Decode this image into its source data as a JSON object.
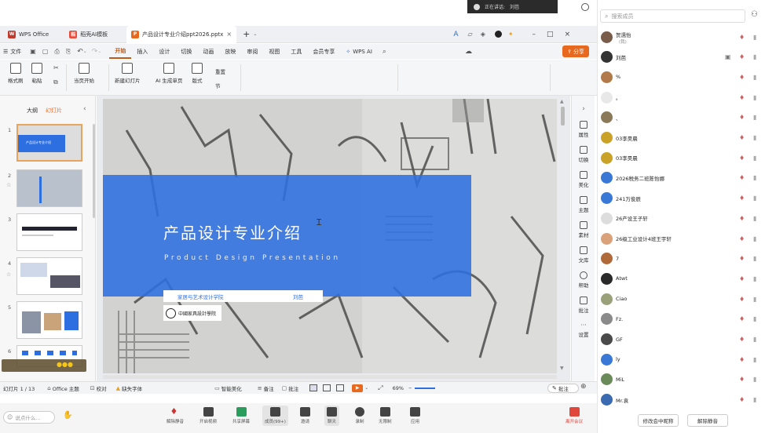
{
  "speaking": {
    "label": "正在讲话:",
    "name": "刘芭"
  },
  "tabs": [
    {
      "label": "WPS Office",
      "logo": "W",
      "color": "#c0392b"
    },
    {
      "label": "稻壳AI模板",
      "logo": "稻",
      "color": "#e74c3c"
    },
    {
      "label": "产品设计专业介绍ppt2026.pptx",
      "logo": "P",
      "color": "#e8681e"
    }
  ],
  "menu": {
    "file": "文件",
    "items": [
      "开始",
      "插入",
      "设计",
      "切换",
      "动画",
      "放映",
      "审阅",
      "视图",
      "工具",
      "会员专享"
    ],
    "wps_ai": "WPS AI",
    "share": "分享"
  },
  "ribbon": {
    "format_painter": "格式刷",
    "paste": "粘贴",
    "play_from_current": "当页开始",
    "new_slide": "新建幻灯片",
    "ai_generate": "AI 生成单页",
    "layout": "版式",
    "section": "节",
    "reset": "重置"
  },
  "outline": {
    "tab_outline": "大纲",
    "tab_slides": "幻灯片"
  },
  "slides": [
    "1",
    "2",
    "3",
    "4",
    "5",
    "6"
  ],
  "thumb1_title": "产品设计专业介绍",
  "slide": {
    "title": "产品设计专业介绍",
    "subtitle": "Product Design Presentation",
    "department": "家居与艺术设计学院",
    "author": "刘芭",
    "seal_text": "中國家具設計學院"
  },
  "rail": [
    "属性",
    "切换",
    "美化",
    "主题",
    "素材",
    "文库",
    "帮助",
    "批注",
    "设置"
  ],
  "statusbar": {
    "slide_count": "幻灯片 1 / 13",
    "theme": "Office 主题",
    "proofread": "校对",
    "missing_font": "缺失字体",
    "smart_beautify": "智能美化",
    "notes": "备注",
    "comments": "批注",
    "zoom": "69%",
    "annotate": "批注"
  },
  "meeting": {
    "say_something": "说点什么...",
    "controls": [
      "解除静音",
      "开启视频",
      "共享屏幕",
      "成员(99+)",
      "邀请",
      "聊天",
      "录制",
      "无限制",
      "应用"
    ],
    "leave": "离开会议"
  },
  "panel": {
    "search_placeholder": "搜索成员",
    "members": [
      {
        "name": "贺濡怡",
        "sub": "(我)",
        "color": "#7a5c4a"
      },
      {
        "name": "刘芭",
        "sub": "",
        "color": "#333333"
      },
      {
        "name": "%",
        "sub": "",
        "color": "#b07a4a"
      },
      {
        "name": "。",
        "sub": "",
        "color": "#e8e8e8"
      },
      {
        "name": "、",
        "sub": "",
        "color": "#8a7a5a"
      },
      {
        "name": "03李昊晨",
        "sub": "",
        "color": "#c9a227"
      },
      {
        "name": "03李昊晨",
        "sub": "",
        "color": "#c9a227"
      },
      {
        "name": "2026税务二班陈怡娜",
        "sub": "",
        "color": "#3a78d6"
      },
      {
        "name": "241万俊辰",
        "sub": "",
        "color": "#3a78d6"
      },
      {
        "name": "26产设王子轩",
        "sub": "",
        "color": "#dddddd"
      },
      {
        "name": "26级工业设计4班王宇轩",
        "sub": "",
        "color": "#d9a27a"
      },
      {
        "name": "7",
        "sub": "",
        "color": "#b06a3a"
      },
      {
        "name": "Atwt",
        "sub": "",
        "color": "#2a2a2a"
      },
      {
        "name": "Ciao",
        "sub": "",
        "color": "#9aa07a"
      },
      {
        "name": "Fz.",
        "sub": "",
        "color": "#8a8a8a"
      },
      {
        "name": "GF",
        "sub": "",
        "color": "#4a4a4a"
      },
      {
        "name": "ly",
        "sub": "",
        "color": "#3a78d6"
      },
      {
        "name": "MiL",
        "sub": "",
        "color": "#6a8a5a"
      },
      {
        "name": "Mr.袁",
        "sub": "",
        "color": "#3a6ab0"
      }
    ],
    "rename_button": "修改会中昵称",
    "unmute_button": "解除静音"
  },
  "colors": {
    "accent": "#e8681e",
    "banner": "#2d6fe0"
  }
}
